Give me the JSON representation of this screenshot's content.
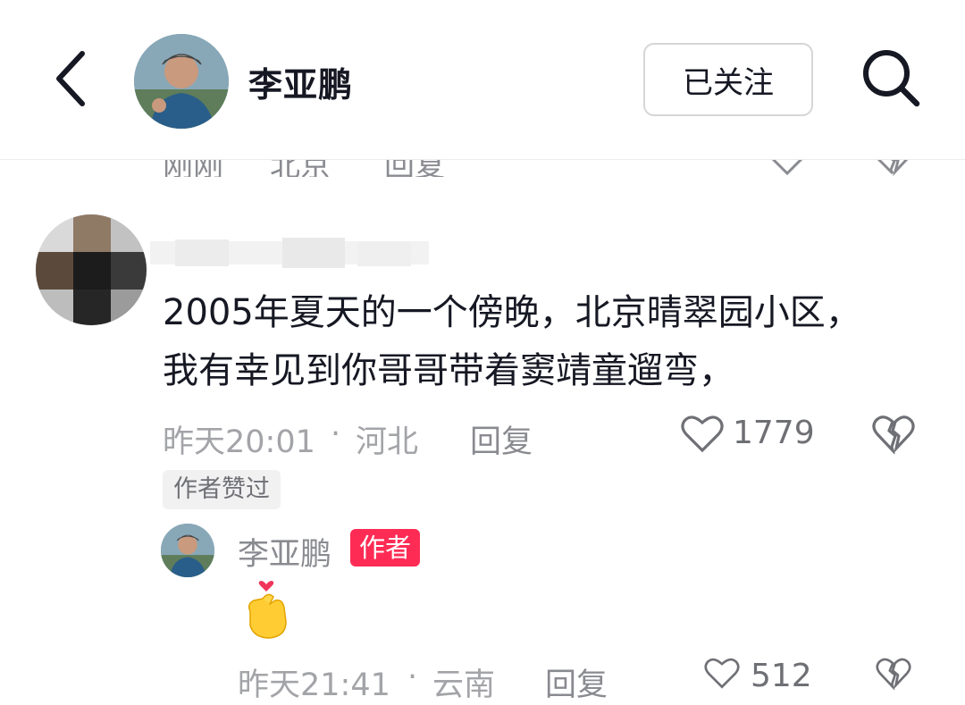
{
  "header": {
    "title": "李亚鹏",
    "follow_label": "已关注",
    "back_icon": "chevron-left-icon",
    "search_icon": "search-icon"
  },
  "previous_comment": {
    "time": "刚刚",
    "location": "北京",
    "reply_label": "回复"
  },
  "comment": {
    "text": "2005年夏天的一个傍晚，北京晴翠园小区，我有幸见到你哥哥带着窦靖童遛弯，",
    "time": "昨天20:01",
    "separator": "·",
    "location": "河北",
    "reply_label": "回复",
    "like_count": "1779",
    "author_liked_tag": "作者赞过"
  },
  "reply": {
    "author": "李亚鹏",
    "author_badge": "作者",
    "emoji": "finger-heart-emoji",
    "time": "昨天21:41",
    "separator": "·",
    "location": "云南",
    "reply_label": "回复",
    "like_count": "512"
  },
  "colors": {
    "accent": "#fe2c55",
    "meta_text": "#a3a4a8",
    "main_text": "#161823"
  }
}
